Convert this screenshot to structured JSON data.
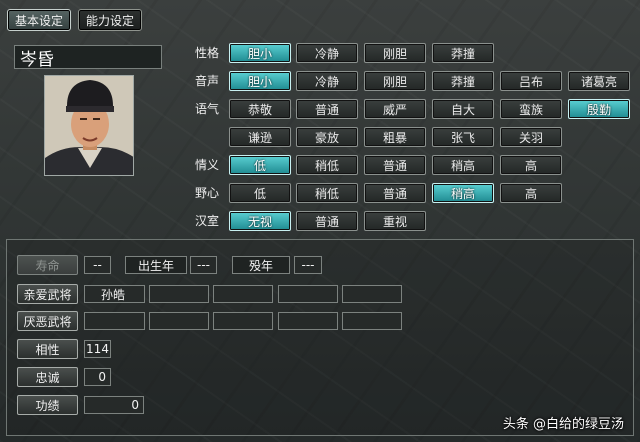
{
  "tabs": [
    {
      "label": "基本设定",
      "active": true
    },
    {
      "label": "能力设定",
      "active": false
    }
  ],
  "character": {
    "name": "岑昏"
  },
  "attributes": [
    {
      "label": "性格",
      "options": [
        "胆小",
        "冷静",
        "刚胆",
        "莽撞"
      ],
      "selected": 0
    },
    {
      "label": "音声",
      "options": [
        "胆小",
        "冷静",
        "刚胆",
        "莽撞",
        "吕布",
        "诸葛亮"
      ],
      "selected": 0
    },
    {
      "label": "语气",
      "options": [
        "恭敬",
        "普通",
        "威严",
        "自大",
        "蛮族",
        "殷勤",
        "谦逊",
        "豪放",
        "粗暴",
        "张飞",
        "关羽"
      ],
      "selected": 5
    },
    {
      "label": "情义",
      "options": [
        "低",
        "稍低",
        "普通",
        "稍高",
        "高"
      ],
      "selected": 0
    },
    {
      "label": "野心",
      "options": [
        "低",
        "稍低",
        "普通",
        "稍高",
        "高"
      ],
      "selected": 3
    },
    {
      "label": "汉室",
      "options": [
        "无视",
        "普通",
        "重视"
      ],
      "selected": 0
    }
  ],
  "lower": {
    "lifespan_label": "寿命",
    "lifespan_value": "--",
    "birth_label": "出生年",
    "birth_value": "---",
    "death_label": "殁年",
    "death_value": "---",
    "favored_label": "亲爱武将",
    "favored": [
      "孙皓",
      "",
      "",
      "",
      ""
    ],
    "disliked_label": "厌恶武将",
    "disliked": [
      "",
      "",
      "",
      "",
      ""
    ],
    "affinity_label": "相性",
    "affinity_value": "114",
    "loyalty_label": "忠诚",
    "loyalty_value": "0",
    "merit_label": "功绩",
    "merit_value": "0"
  },
  "watermark": "头条 @白给的绿豆汤",
  "colors": {
    "selected": "#36b3b8",
    "background": "#323736"
  }
}
